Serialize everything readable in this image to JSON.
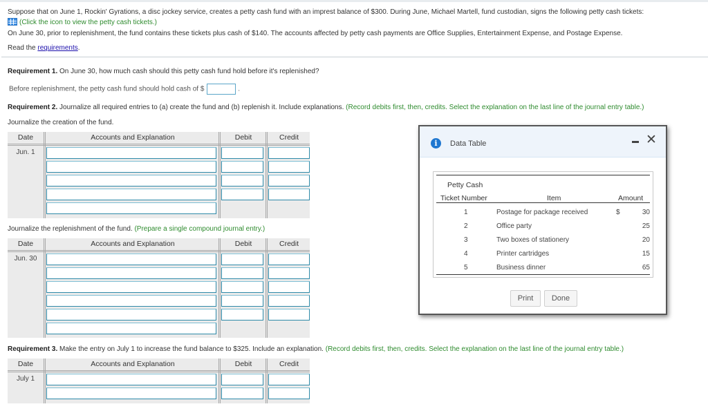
{
  "intro": {
    "line1": "Suppose that on June 1, Rockin' Gyrations, a disc jockey service, creates a petty cash fund with an imprest balance of $300. During June, Michael Martell, fund custodian, signs the following petty cash tickets:",
    "tickets_link": "(Click the icon to view the petty cash tickets.)",
    "line3": "On June 30, prior to replenishment, the fund contains these tickets plus cash of $140. The accounts affected by petty cash payments are Office Supplies, Entertainment Expense, and Postage Expense.",
    "read_the": "Read the ",
    "requirements_link": "requirements",
    "period": "."
  },
  "req1": {
    "label": "Requirement 1.",
    "text": " On June 30, how much cash should this petty cash fund hold before it's replenished?",
    "answer_prefix": "Before replenishment, the petty cash fund should hold cash of $",
    "answer_value": "",
    "answer_suffix": "."
  },
  "req2": {
    "label": "Requirement 2.",
    "text": " Journalize all required entries to (a) create the fund and (b) replenish it. Include explanations. ",
    "instruction": "(Record debits first, then, credits. Select the explanation on the last line of the journal entry table.)",
    "creation_label": "Journalize the creation of the fund.",
    "replenish_label": "Journalize the replenishment of the fund. ",
    "replenish_instruction": "(Prepare a single compound journal entry.)"
  },
  "req3": {
    "label": "Requirement 3.",
    "text": " Make the entry on July 1 to increase the fund balance to $325. Include an explanation. ",
    "instruction": "(Record debits first, then, credits. Select the explanation on the last line of the journal entry table.)"
  },
  "journal_headers": {
    "date": "Date",
    "accounts": "Accounts and Explanation",
    "debit": "Debit",
    "credit": "Credit"
  },
  "journals": {
    "creation": {
      "date": "Jun. 1",
      "entry_rows": 4,
      "explanation_row": true
    },
    "replenishment": {
      "date": "Jun. 30",
      "entry_rows": 5,
      "explanation_row": true
    },
    "increase": {
      "date": "July 1",
      "entry_rows": 2,
      "explanation_row": false
    }
  },
  "dialog": {
    "title": "Data Table",
    "header_line1": "Petty Cash",
    "col_ticket": "Ticket Number",
    "col_item": "Item",
    "col_amount": "Amount",
    "currency": "$",
    "rows": [
      {
        "ticket": "1",
        "item": "Postage for package received",
        "amount": "30"
      },
      {
        "ticket": "2",
        "item": "Office party",
        "amount": "25"
      },
      {
        "ticket": "3",
        "item": "Two boxes of stationery",
        "amount": "20"
      },
      {
        "ticket": "4",
        "item": "Printer cartridges",
        "amount": "15"
      },
      {
        "ticket": "5",
        "item": "Business dinner",
        "amount": "65"
      }
    ],
    "print_label": "Print",
    "done_label": "Done"
  }
}
